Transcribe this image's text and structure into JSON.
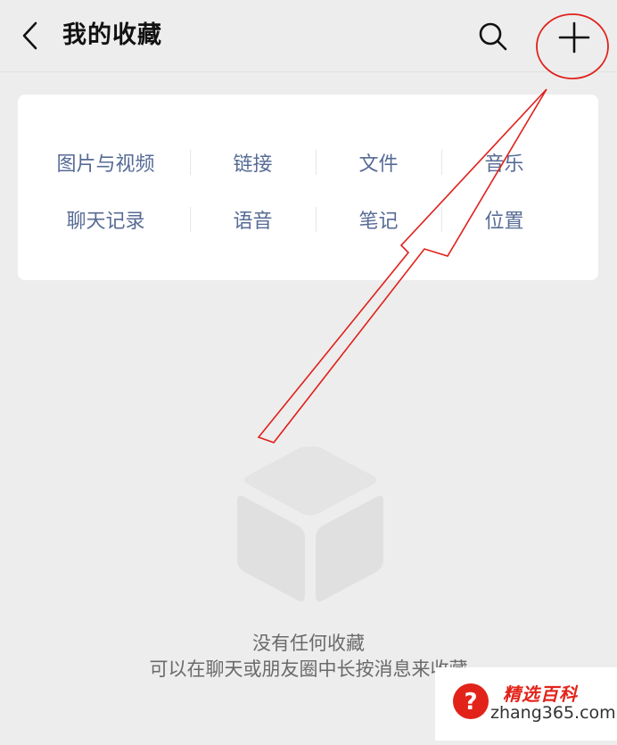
{
  "header": {
    "title": "我的收藏",
    "back_icon": "chevron-left-icon",
    "search_icon": "search-icon",
    "add_icon": "plus-icon"
  },
  "categories": {
    "row1": [
      "图片与视频",
      "链接",
      "文件",
      "音乐"
    ],
    "row2": [
      "聊天记录",
      "语音",
      "笔记",
      "位置"
    ]
  },
  "empty_state": {
    "title": "没有任何收藏",
    "description": "可以在聊天或朋友圈中长按消息来收藏"
  },
  "annotation": {
    "color": "#e0201b"
  },
  "watermark": {
    "brand": "精选百科",
    "domain": "zhang365.com",
    "logo_icon": "question-mark-icon"
  },
  "colors": {
    "background": "#ededed",
    "link": "#576b95",
    "muted_text": "#6a6a6a"
  }
}
